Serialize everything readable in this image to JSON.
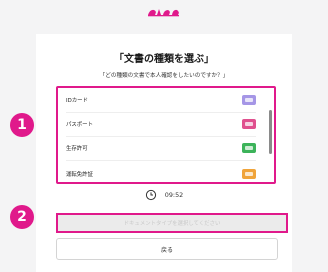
{
  "header": {
    "logo_icon": "brand-logo-icon",
    "logo_color": "#e0198b"
  },
  "page": {
    "title": "「文書の種類を選ぶ」",
    "subtitle": "「どの種類の文書で本人確認をしたいのですか？」"
  },
  "document_list": {
    "items": [
      {
        "label": "IDカード",
        "icon": "id-card-icon",
        "color": "#a596e6"
      },
      {
        "label": "パスポート",
        "icon": "passport-icon",
        "color": "#e0508e"
      },
      {
        "label": "生存許可",
        "icon": "residence-permit-icon",
        "color": "#3cb35a"
      },
      {
        "label": "運転免許証",
        "icon": "drivers-license-icon",
        "color": "#f0a43a"
      }
    ]
  },
  "timer": {
    "icon": "clock-icon",
    "time": "09:52"
  },
  "annotations": {
    "badge_1": "1",
    "badge_2": "2",
    "color": "#e0198b"
  },
  "buttons": {
    "select_label": "ドキュメントタイプを選択してください",
    "back_label": "戻る"
  }
}
